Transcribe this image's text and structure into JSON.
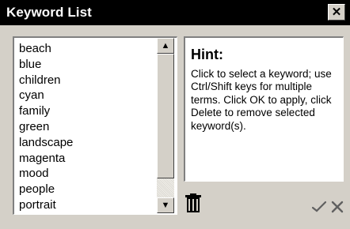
{
  "window": {
    "title": "Keyword List",
    "close_glyph": "✕"
  },
  "keywords": [
    "beach",
    "blue",
    "children",
    "cyan",
    "family",
    "green",
    "landscape",
    "magenta",
    "mood",
    "people",
    "portrait"
  ],
  "scrollbar": {
    "up_glyph": "▲",
    "down_glyph": "▼"
  },
  "hint": {
    "title": "Hint:",
    "text": "Click to select a keyword; use Ctrl/Shift keys for multiple terms. Click OK to apply, click Delete to remove selected keyword(s)."
  },
  "actions": {
    "delete_icon": "trash-icon",
    "ok_icon": "checkmark-icon",
    "cancel_icon": "close-x-icon"
  }
}
